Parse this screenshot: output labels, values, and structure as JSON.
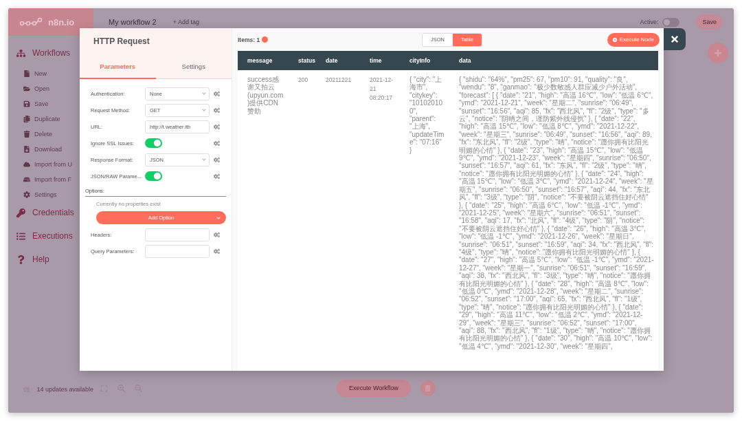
{
  "app": {
    "logo": "n8n.io",
    "workflow_name": "My workflow 2",
    "add_tag": "+ Add tag",
    "active_label": "Active:",
    "active": false,
    "save": "Save",
    "sidebar": [
      {
        "label": "Workflows",
        "children": [
          {
            "label": "New"
          },
          {
            "label": "Open"
          },
          {
            "label": "Save"
          },
          {
            "label": "Duplicate"
          },
          {
            "label": "Delete"
          },
          {
            "label": "Download"
          },
          {
            "label": "Import from U"
          },
          {
            "label": "Import from F"
          },
          {
            "label": "Settings"
          }
        ]
      },
      {
        "label": "Credentials"
      },
      {
        "label": "Executions"
      },
      {
        "label": "Help"
      }
    ],
    "updates": "14 updates available",
    "execute_workflow": "Execute Workflow"
  },
  "dialog": {
    "title": "HTTP Request",
    "tabs": [
      {
        "label": "Parameters",
        "selected": true
      },
      {
        "label": "Settings",
        "selected": false
      }
    ],
    "fields": [
      {
        "label": "Authentication:",
        "kind": "select",
        "value": "None"
      },
      {
        "label": "Request Method:",
        "kind": "select",
        "value": "GET"
      },
      {
        "label": "URL:",
        "kind": "input",
        "value": "http://t.weather.itb"
      },
      {
        "label": "Ignore SSL Issues:",
        "kind": "toggle",
        "on": true
      },
      {
        "label": "Response Format:",
        "kind": "select",
        "value": "JSON"
      },
      {
        "label": "JSON/RAW Parame...",
        "kind": "toggle",
        "on": true
      }
    ],
    "options": {
      "title": "Options:",
      "empty_text": "Currently no properties exist",
      "add_button": "Add Option"
    },
    "more_fields": [
      {
        "label": "Headers:",
        "kind": "input"
      },
      {
        "label": "Query Parameters:",
        "kind": "input"
      }
    ],
    "output": {
      "items_label": "Items: 1",
      "views": [
        {
          "label": "JSON",
          "selected": false
        },
        {
          "label": "Table",
          "selected": true
        }
      ],
      "execute_node": "Execute Node",
      "table": {
        "columns": [
          "message",
          "status",
          "date",
          "time",
          "cityInfo",
          "data"
        ],
        "rows": [
          [
            "success感谢又拍云(upyun.com)提供CDN赞助",
            "200",
            "20211221",
            "2021-12-21 08:20:17",
            "{ \"city\": \"上海市\", \"citykey\": \"101020100\", \"parent\": \"上海\", \"updateTime\": \"07:16\" }",
            "{ \"shidu\": \"64%\", \"pm25\": 67, \"pm10\": 91, \"quality\": \"良\", \"wendu\": \"8\", \"ganmao\": \"极少数敏感人群应减少户外活动\", \"forecast\": [ { \"date\": \"21\", \"high\": \"高温 16℃\", \"low\": \"低温 6℃\", \"ymd\": \"2021-12-21\", \"week\": \"星期二\", \"sunrise\": \"06:49\", \"sunset\": \"16:56\", \"aqi\": 85, \"fx\": \"西北风\", \"fl\": \"2级\", \"type\": \"多云\", \"notice\": \"阴晴之间，谨防紫外线侵扰\" }, { \"date\": \"22\", \"high\": \"高温 15℃\", \"low\": \"低温 8℃\", \"ymd\": \"2021-12-22\", \"week\": \"星期三\", \"sunrise\": \"06:49\", \"sunset\": \"16:56\", \"aqi\": 89, \"fx\": \"东北风\", \"fl\": \"2级\", \"type\": \"晴\", \"notice\": \"愿你拥有比阳光明媚的心情\" }, { \"date\": \"23\", \"high\": \"高温 15℃\", \"low\": \"低温 9℃\", \"ymd\": \"2021-12-23\", \"week\": \"星期四\", \"sunrise\": \"06:50\", \"sunset\": \"16:57\", \"aqi\": 61, \"fx\": \"东风\", \"fl\": \"2级\", \"type\": \"晴\", \"notice\": \"愿你拥有比阳光明媚的心情\" }, { \"date\": \"24\", \"high\": \"高温 15℃\", \"low\": \"低温 3℃\", \"ymd\": \"2021-12-24\", \"week\": \"星期五\", \"sunrise\": \"06:50\", \"sunset\": \"16:57\", \"aqi\": 44, \"fx\": \"东北风\", \"fl\": \"3级\", \"type\": \"阴\", \"notice\": \"不要被阴云遮挡住好心情\" }, { \"date\": \"25\", \"high\": \"高温 6℃\", \"low\": \"低温 -1℃\", \"ymd\": \"2021-12-25\", \"week\": \"星期六\", \"sunrise\": \"06:51\", \"sunset\": \"16:58\", \"aqi\": 17, \"fx\": \"北风\", \"fl\": \"4级\", \"type\": \"阴\", \"notice\": \"不要被阴云遮挡住好心情\" }, { \"date\": \"26\", \"high\": \"高温 3℃\", \"low\": \"低温 -1℃\", \"ymd\": \"2021-12-26\", \"week\": \"星期日\", \"sunrise\": \"06:51\", \"sunset\": \"16:59\", \"aqi\": 34, \"fx\": \"西北风\", \"fl\": \"4级\", \"type\": \"晴\", \"notice\": \"愿你拥有比阳光明媚的心情\" }, { \"date\": \"27\", \"high\": \"高温 5℃\", \"low\": \"低温 -1℃\", \"ymd\": \"2021-12-27\", \"week\": \"星期一\", \"sunrise\": \"06:51\", \"sunset\": \"16:59\", \"aqi\": 38, \"fx\": \"西北风\", \"fl\": \"3级\", \"type\": \"晴\", \"notice\": \"愿你拥有比阳光明媚的心情\" }, { \"date\": \"28\", \"high\": \"高温 8℃\", \"low\": \"低温 0℃\", \"ymd\": \"2021-12-28\", \"week\": \"星期二\", \"sunrise\": \"06:52\", \"sunset\": \"17:00\", \"aqi\": 65, \"fx\": \"西北风\", \"fl\": \"1级\", \"type\": \"晴\", \"notice\": \"愿你拥有比阳光明媚的心情\" }, { \"date\": \"29\", \"high\": \"高温 11℃\", \"low\": \"低温 2℃\", \"ymd\": \"2021-12-29\", \"week\": \"星期三\", \"sunrise\": \"06:52\", \"sunset\": \"17:00\", \"aqi\": 88, \"fx\": \"西北风\", \"fl\": \"1级\", \"type\": \"晴\", \"notice\": \"愿你拥有比阳光明媚的心情\" }, { \"date\": \"30\", \"high\": \"高温 10℃\", \"low\": \"低温 4℃\", \"ymd\": \"2021-12-30\", \"week\": \"星期四\","
          ]
        ]
      }
    }
  }
}
